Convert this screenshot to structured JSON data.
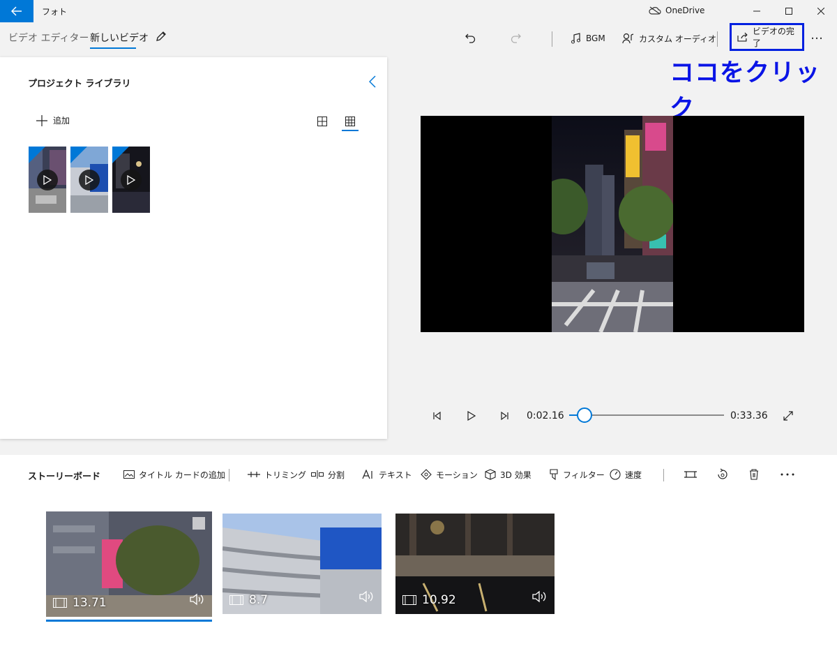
{
  "titlebar": {
    "app_title": "フォト",
    "onedrive_label": "OneDrive",
    "icons": [
      "back-arrow-icon",
      "cloud-icon",
      "minimize-icon",
      "maximize-icon",
      "close-icon"
    ]
  },
  "breadcrumb": {
    "root": "ビデオ エディター",
    "current": "新しいビデオ"
  },
  "commands": {
    "bgm": "BGM",
    "custom_audio": "カスタム オーディオ",
    "finish_video": "ビデオの完了",
    "more": "…"
  },
  "annotation": {
    "text": "ココをクリック",
    "color": "#0a14e6"
  },
  "library": {
    "title": "プロジェクト ライブラリ",
    "add_label": "追加",
    "items": [
      {
        "name": "library-item-1"
      },
      {
        "name": "library-item-2"
      },
      {
        "name": "library-item-3"
      }
    ]
  },
  "player": {
    "current_time": "0:02.16",
    "total_time": "0:33.36",
    "progress": 0.065
  },
  "storyboard": {
    "title": "ストーリーボード",
    "tools": {
      "title_card": "タイトル カードの追加",
      "trim": "トリミング",
      "split": "分割",
      "text": "テキスト",
      "motion": "モーション",
      "effects_3d": "3D 効果",
      "filters": "フィルター",
      "speed": "速度"
    },
    "clips": [
      {
        "duration": "13.71",
        "selected": true
      },
      {
        "duration": "8.7",
        "selected": false
      },
      {
        "duration": "10.92",
        "selected": false
      }
    ]
  },
  "colors": {
    "accent": "#0078d7",
    "highlight_box": "#0020e0"
  }
}
